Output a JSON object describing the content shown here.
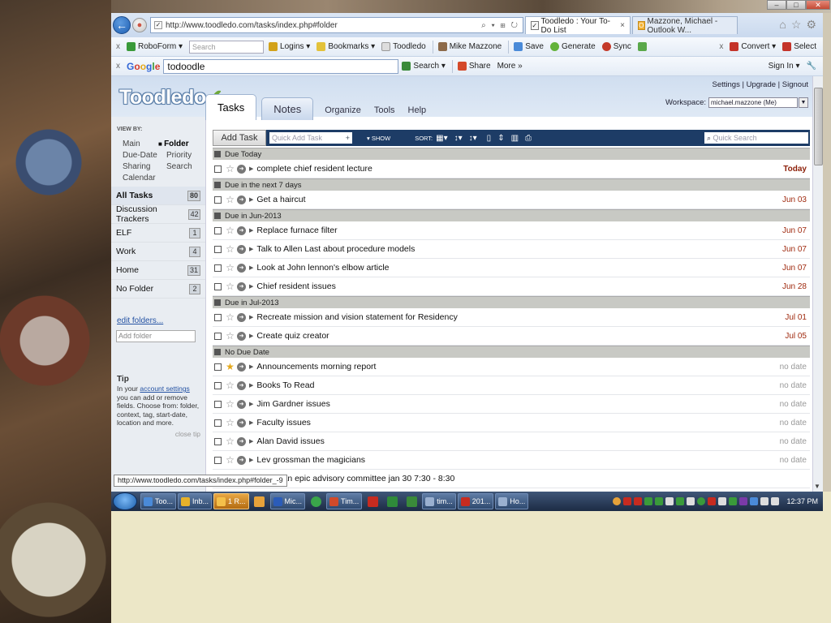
{
  "browser": {
    "url": "http://www.toodledo.com/tasks/index.php#folder",
    "tabs": [
      {
        "title": "Toodledo : Your To-Do List",
        "close": "×"
      },
      {
        "title": "Mazzone, Michael - Outlook W...",
        "close": ""
      }
    ],
    "status_url": "http://www.toodledo.com/tasks/index.php#folder_-9"
  },
  "window_controls": {
    "minimize": "–",
    "maximize": "□",
    "close": "✕"
  },
  "roboform_bar": {
    "close": "x",
    "roboform": "RoboForm ▾",
    "search_placeholder": "Search",
    "logins": "Logins ▾",
    "bookmarks": "Bookmarks ▾",
    "toodledo": "Toodledo",
    "mike": "Mike Mazzone",
    "save": "Save",
    "generate": "Generate",
    "sync": "Sync",
    "convert": "Convert ▾",
    "select": "Select"
  },
  "google_bar": {
    "close": "x",
    "logo": "Google",
    "query": "todoodle",
    "search": "Search ▾",
    "share": "Share",
    "more": "More »",
    "signin": "Sign In ▾"
  },
  "app": {
    "logo": "Toodledo",
    "top_links": "Settings | Upgrade | Signout",
    "workspace_label": "Workspace:",
    "workspace_value": "michael.mazzone (Me)",
    "main_tabs": {
      "tasks": "Tasks",
      "notes": "Notes"
    },
    "links": {
      "organize": "Organize",
      "tools": "Tools",
      "help": "Help"
    }
  },
  "sidebar": {
    "view_by": "VIEW BY:",
    "views": {
      "main": "Main",
      "folder": "Folder",
      "due_date": "Due-Date",
      "priority": "Priority",
      "sharing": "Sharing",
      "search": "Search",
      "calendar": "Calendar"
    },
    "folders": [
      {
        "name": "All Tasks",
        "count": "80"
      },
      {
        "name": "Discussion Trackers",
        "count": "42"
      },
      {
        "name": "ELF",
        "count": "1"
      },
      {
        "name": "Work",
        "count": "4"
      },
      {
        "name": "Home",
        "count": "31"
      },
      {
        "name": "No Folder",
        "count": "2"
      }
    ],
    "edit_folders": "edit folders...",
    "add_folder_placeholder": "Add folder",
    "tip_title": "Tip",
    "tip_pre": "In your",
    "tip_link": "account settings",
    "tip_post": "you can add or remove fields. Choose from: folder, context, tag, start-date, location and more.",
    "close_tip": "close tip"
  },
  "toolbar": {
    "add_task": "Add Task",
    "quick_add_placeholder": "Quick Add Task",
    "show": "▾  SHOW",
    "sort": "SORT:",
    "quick_search_placeholder": "Quick Search"
  },
  "groups": [
    {
      "header": "Due Today",
      "tasks": [
        {
          "title": "complete chief resident lecture",
          "due": "Today"
        }
      ]
    },
    {
      "header": "Due in the next 7 days",
      "tasks": [
        {
          "title": "Get a haircut",
          "due": "Jun 03"
        }
      ]
    },
    {
      "header": "Due in Jun-2013",
      "tasks": [
        {
          "title": "Replace furnace filter",
          "due": "Jun 07"
        },
        {
          "title": "Talk to Allen Last about procedure models",
          "due": "Jun 07"
        },
        {
          "title": "Look at John lennon's elbow article",
          "due": "Jun 07"
        },
        {
          "title": "Chief resident issues",
          "due": "Jun 28"
        }
      ]
    },
    {
      "header": "Due in Jul-2013",
      "tasks": [
        {
          "title": "Recreate mission and vision statement for Residency",
          "due": "Jul 01"
        },
        {
          "title": "Create quiz creator",
          "due": "Jul 05"
        }
      ]
    },
    {
      "header": "No Due Date",
      "tasks": [
        {
          "title": "Announcements morning report",
          "due": "no date",
          "starred": true
        },
        {
          "title": "Books To Read",
          "due": "no date"
        },
        {
          "title": "Jim Gardner issues",
          "due": "no date"
        },
        {
          "title": "Faculty issues",
          "due": "no date"
        },
        {
          "title": "Alan David issues",
          "due": "no date"
        },
        {
          "title": "Lev grossman the magicians",
          "due": "no date"
        },
        {
          "title": "physician epic advisory committee jan 30 7:30 - 8:30",
          "due": ""
        }
      ]
    }
  ],
  "taskbar": {
    "items": [
      "Too...",
      "Inb...",
      "1 R...",
      "Mic...",
      "Tim...",
      "tim...",
      "201...",
      "Ho..."
    ],
    "clock": "12:37 PM"
  }
}
